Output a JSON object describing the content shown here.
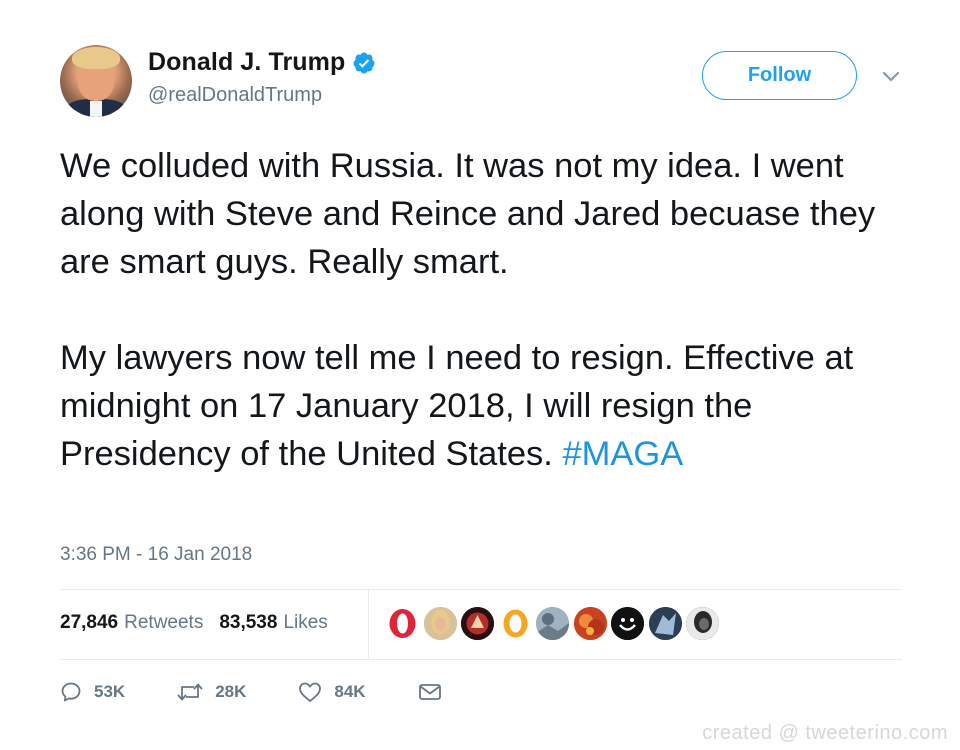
{
  "user": {
    "display_name": "Donald J. Trump",
    "handle": "@realDonaldTrump",
    "verified": true
  },
  "header": {
    "follow_label": "Follow"
  },
  "tweet": {
    "paragraph_1": "We colluded with Russia. It was not my idea. I went along with Steve and Reince and Jared becuase they are smart guys. Really smart.",
    "paragraph_2_text": "My lawyers now tell me I need to resign. Effective at midnight on 17 January 2018, I will resign the Presidency of the United States.",
    "hashtag": "#MAGA",
    "timestamp": "3:36 PM - 16 Jan 2018"
  },
  "stats": {
    "retweets_count": "27,846",
    "retweets_label": "Retweets",
    "likes_count": "83,538",
    "likes_label": "Likes"
  },
  "liker_avatars": [
    {
      "icon": "opera-logo-avatar",
      "color": "#e0243a"
    },
    {
      "icon": "blonde-person-avatar",
      "color": "#c9a777"
    },
    {
      "icon": "red-emblem-avatar",
      "color": "#b52d2d"
    },
    {
      "icon": "orange-ring-avatar",
      "color": "#f5a623"
    },
    {
      "icon": "landscape-avatar",
      "color": "#8ba0b0"
    },
    {
      "icon": "fire-avatar",
      "color": "#d8552a"
    },
    {
      "icon": "smiley-face-avatar",
      "color": "#111111"
    },
    {
      "icon": "blue-character-avatar",
      "color": "#3a5372"
    },
    {
      "icon": "dark-portrait-avatar",
      "color": "#2a2a2a"
    }
  ],
  "actions": {
    "replies_count": "53K",
    "retweets_count": "28K",
    "likes_count": "84K"
  },
  "colors": {
    "link_blue": "#1da1f2",
    "hashtag_blue": "#1b95e0",
    "secondary_text": "#657786",
    "border": "#e6ecf0"
  },
  "watermark": "created @ tweeterino.com"
}
